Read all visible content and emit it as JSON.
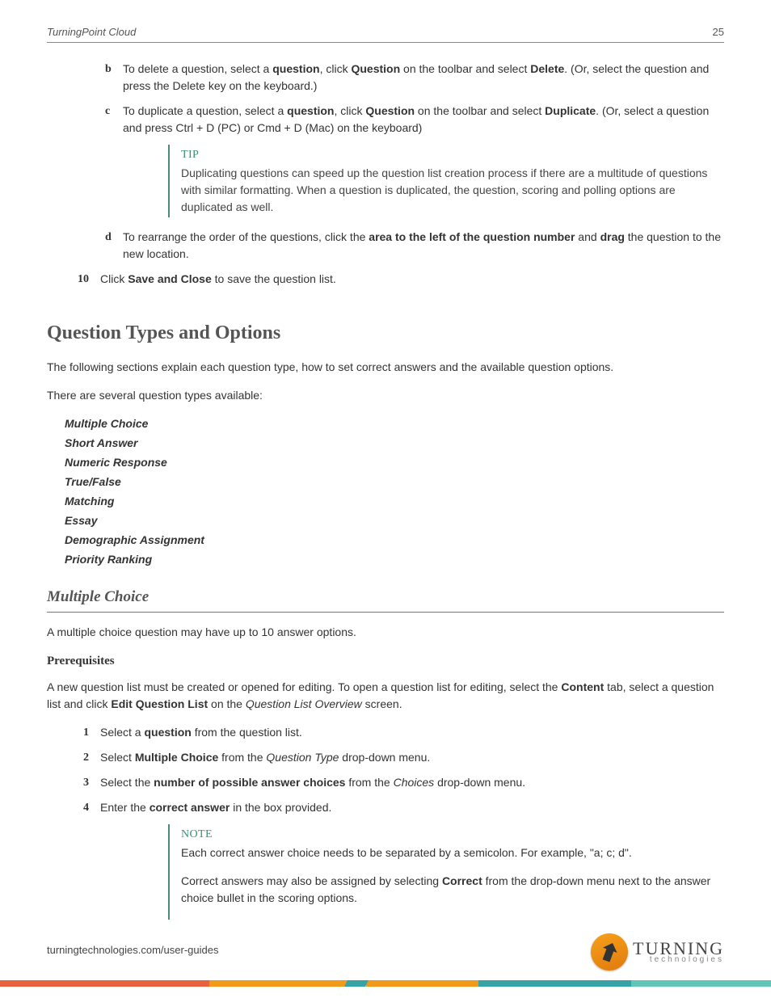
{
  "header": {
    "title": "TurningPoint Cloud",
    "page": "25"
  },
  "steps": {
    "b": {
      "label": "b",
      "text_parts": [
        "To delete a question, select a ",
        "question",
        ", click ",
        "Question",
        " on the toolbar and select ",
        "Delete",
        ". (Or, select the question and press the Delete key on the keyboard.)"
      ]
    },
    "c": {
      "label": "c",
      "text_parts": [
        "To duplicate a question, select a ",
        "question",
        ", click ",
        "Question",
        " on the toolbar and select ",
        "Duplicate",
        ". (Or, select a question and press Ctrl + D (PC) or Cmd + D (Mac) on the keyboard)"
      ]
    },
    "tip": {
      "title": "TIP",
      "body": "Duplicating questions can speed up the question list creation process if there are a multitude of questions with similar formatting. When a question is duplicated, the question, scoring and polling options are duplicated as well."
    },
    "d": {
      "label": "d",
      "text_parts": [
        "To rearrange the order of the questions, click the ",
        "area to the left of the question number",
        " and ",
        "drag",
        " the question to the new location."
      ]
    },
    "ten": {
      "label": "10",
      "text_parts": [
        "Click ",
        "Save and Close",
        " to save the question list."
      ]
    }
  },
  "section": {
    "heading": "Question Types and Options",
    "intro1": "The following sections explain each question type, how to set correct answers and the available question options.",
    "intro2": "There are several question types available:",
    "types": [
      "Multiple Choice",
      "Short Answer",
      "Numeric Response",
      "True/False",
      "Matching",
      "Essay",
      "Demographic Assignment",
      "Priority Ranking"
    ]
  },
  "mc": {
    "heading": "Multiple Choice",
    "desc": "A multiple choice question may have up to 10 answer options.",
    "prereq_heading": "Prerequisites",
    "prereq_parts": [
      "A new question list must be created or opened for editing. To open a question list for editing, select the ",
      "Content",
      " tab, select a question list and click ",
      "Edit Question List",
      " on the ",
      "Question List Overview",
      " screen."
    ],
    "steps": {
      "s1": {
        "label": "1",
        "parts": [
          "Select a ",
          "question",
          " from the question list."
        ]
      },
      "s2": {
        "label": "2",
        "parts": [
          "Select ",
          "Multiple Choice",
          " from the ",
          "Question Type",
          " drop-down menu."
        ]
      },
      "s3": {
        "label": "3",
        "parts": [
          "Select the ",
          "number of possible answer choices",
          " from the ",
          "Choices",
          " drop-down menu."
        ]
      },
      "s4": {
        "label": "4",
        "parts": [
          "Enter the ",
          "correct answer",
          " in the box provided."
        ]
      }
    },
    "note": {
      "title": "NOTE",
      "p1": "Each correct answer choice needs to be separated by a semicolon. For example, \"a; c; d\".",
      "p2_parts": [
        "Correct answers may also be assigned by selecting ",
        "Correct",
        " from the drop-down menu next to the answer choice bullet in the scoring options."
      ]
    }
  },
  "footer": {
    "url": "turningtechnologies.com/user-guides",
    "logo_big": "TURNING",
    "logo_small": "technologies"
  }
}
